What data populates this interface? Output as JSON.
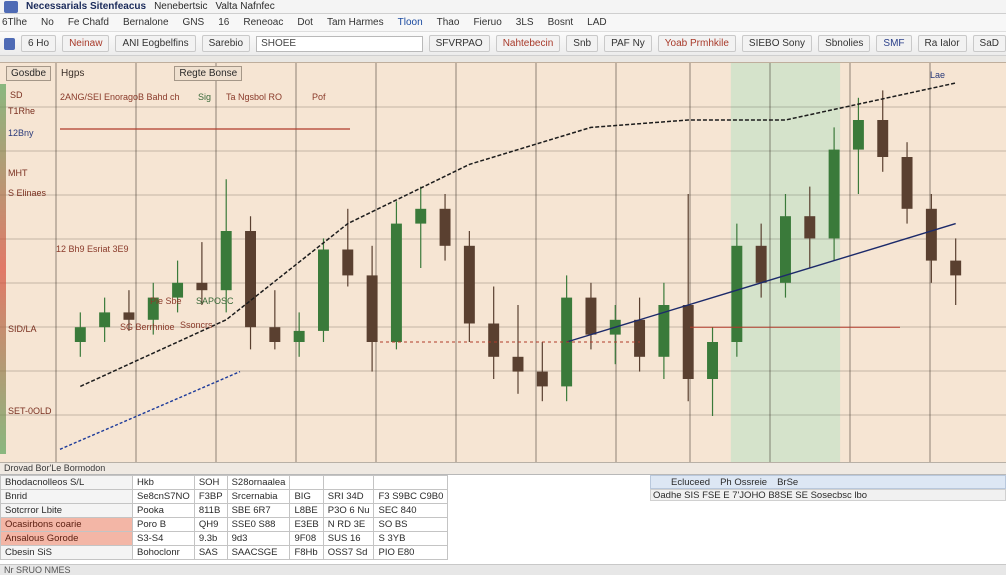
{
  "titlebar": {
    "title": "Necessarials Sitenfeacus",
    "items": [
      "Nenebertsic",
      "Valta Nafnfec"
    ]
  },
  "menubar": {
    "items": [
      "6Tlhe",
      "No",
      "Fe Chafd",
      "Bernalone",
      "GNS",
      "16",
      "Reneoac",
      "Dot",
      "Tam Harmes",
      "Tloon",
      "Thao",
      "Fieruo",
      "3LS",
      "Bosnt",
      "LAD"
    ]
  },
  "toolbar": {
    "b1": "6 Ho",
    "b2": "Neinaw",
    "b3": "ANI Eogbelfins",
    "b4": "Sarebio",
    "search_value": "SHOEE",
    "b5": "SFVRPAO",
    "b6": "Nahtebecin",
    "b7": "Snb",
    "b8": "PAF Ny",
    "b9": "Yoab Prmhkile",
    "b10": "SIEBO Sony",
    "b11": "Sbnolies",
    "b12": "SMF",
    "b13": "Ra Ialor",
    "b14": "SaD"
  },
  "chart_header": {
    "symbol": "Gosdbe",
    "tf": "Hgps",
    "study": "Regte Bonse",
    "right": "Lae"
  },
  "labels": {
    "l1": "SD",
    "l2": "12Bny",
    "l3": "2ANG/SEI Enorago",
    "l4": "B Bahd ch",
    "l5": "Sig",
    "l6": "Ta Ngsbol RO",
    "l7": "Pof",
    "l8": "T1Rhe",
    "l9": "MHT",
    "l10": "S Elinaes",
    "l11": "12 Bh9 Esriat 3E9",
    "l12": "Pie Sbe",
    "l13": "SAPOSC",
    "l14": "SG Berrhnioe",
    "l15": "SID/LA",
    "l16": "SET-0OLD",
    "l17": "Ssoncrs"
  },
  "status_strip": {
    "text": "Drovad Bor'Le Bormodon"
  },
  "table": {
    "headers": [
      "Bhodacnolleos S/L",
      "Hkb",
      "SOH",
      "S28ornaalea",
      "",
      "",
      "",
      ""
    ],
    "rows": [
      {
        "head": "Bnrid",
        "cells": [
          "Se8cnS7NO",
          "F3BP",
          "Srcernabia",
          "BIG",
          "SRI 34D",
          "F3 S9BC C9B0"
        ]
      },
      {
        "head": "Sotcrror Lbite",
        "cells": [
          "Pooka",
          "811B",
          "SBE 6R7",
          "L8BE",
          "P3O 6 Nu",
          "SEC 840"
        ]
      },
      {
        "head": "Ocasirbons coarie",
        "cells": [
          "Poro B",
          "QH9",
          "SSE0 S88",
          "E3EB",
          "N RD 3E",
          "SO BS"
        ]
      },
      {
        "head": "Ansalous Gorode",
        "cells": [
          "S3-S4",
          "9.3b",
          "9d3",
          "9F08",
          "SUS 16",
          "S 3YB"
        ]
      },
      {
        "head": "Cbesin SiS",
        "cells": [
          "Bohoclonr",
          "SAS",
          "SAACSGE",
          "F8Hb",
          "OSS7 Sd",
          "PIO E80"
        ]
      }
    ],
    "strip_top": [
      "Ecluceed",
      "Ph Ossreie",
      "BrSe"
    ],
    "strip_bottom": "Oadhe SIS FSE E 7'JOHO B8SE SE Sosecbsc lbo"
  },
  "footer": {
    "text": "Nr SRUO NMES"
  },
  "chart_data": {
    "type": "candlestick",
    "title": "",
    "xlabel": "",
    "ylabel": "",
    "ylim": [
      0,
      100
    ],
    "candles": [
      {
        "x": 1,
        "o": 30,
        "h": 38,
        "l": 26,
        "c": 34,
        "up": true
      },
      {
        "x": 2,
        "o": 34,
        "h": 42,
        "l": 30,
        "c": 38,
        "up": true
      },
      {
        "x": 3,
        "o": 38,
        "h": 44,
        "l": 33,
        "c": 36,
        "up": false
      },
      {
        "x": 4,
        "o": 36,
        "h": 46,
        "l": 32,
        "c": 42,
        "up": true
      },
      {
        "x": 5,
        "o": 42,
        "h": 52,
        "l": 38,
        "c": 46,
        "up": true
      },
      {
        "x": 6,
        "o": 46,
        "h": 57,
        "l": 40,
        "c": 44,
        "up": false
      },
      {
        "x": 7,
        "o": 44,
        "h": 74,
        "l": 38,
        "c": 60,
        "up": true
      },
      {
        "x": 8,
        "o": 60,
        "h": 64,
        "l": 28,
        "c": 34,
        "up": false
      },
      {
        "x": 9,
        "o": 34,
        "h": 44,
        "l": 28,
        "c": 30,
        "up": false
      },
      {
        "x": 10,
        "o": 30,
        "h": 38,
        "l": 26,
        "c": 33,
        "up": true
      },
      {
        "x": 11,
        "o": 33,
        "h": 58,
        "l": 30,
        "c": 55,
        "up": true
      },
      {
        "x": 12,
        "o": 55,
        "h": 66,
        "l": 45,
        "c": 48,
        "up": false
      },
      {
        "x": 13,
        "o": 48,
        "h": 56,
        "l": 22,
        "c": 30,
        "up": false
      },
      {
        "x": 14,
        "o": 30,
        "h": 68,
        "l": 28,
        "c": 62,
        "up": true
      },
      {
        "x": 15,
        "o": 62,
        "h": 72,
        "l": 50,
        "c": 66,
        "up": true
      },
      {
        "x": 16,
        "o": 66,
        "h": 70,
        "l": 52,
        "c": 56,
        "up": false
      },
      {
        "x": 17,
        "o": 56,
        "h": 60,
        "l": 30,
        "c": 35,
        "up": false
      },
      {
        "x": 18,
        "o": 35,
        "h": 45,
        "l": 20,
        "c": 26,
        "up": false
      },
      {
        "x": 19,
        "o": 26,
        "h": 40,
        "l": 16,
        "c": 22,
        "up": false
      },
      {
        "x": 20,
        "o": 22,
        "h": 30,
        "l": 14,
        "c": 18,
        "up": false
      },
      {
        "x": 21,
        "o": 18,
        "h": 48,
        "l": 14,
        "c": 42,
        "up": true
      },
      {
        "x": 22,
        "o": 42,
        "h": 46,
        "l": 28,
        "c": 32,
        "up": false
      },
      {
        "x": 23,
        "o": 32,
        "h": 40,
        "l": 24,
        "c": 36,
        "up": true
      },
      {
        "x": 24,
        "o": 36,
        "h": 42,
        "l": 22,
        "c": 26,
        "up": false
      },
      {
        "x": 25,
        "o": 26,
        "h": 46,
        "l": 20,
        "c": 40,
        "up": true
      },
      {
        "x": 26,
        "o": 40,
        "h": 70,
        "l": 14,
        "c": 20,
        "up": false
      },
      {
        "x": 27,
        "o": 20,
        "h": 34,
        "l": 10,
        "c": 30,
        "up": true
      },
      {
        "x": 28,
        "o": 30,
        "h": 62,
        "l": 26,
        "c": 56,
        "up": true
      },
      {
        "x": 29,
        "o": 56,
        "h": 62,
        "l": 42,
        "c": 46,
        "up": false
      },
      {
        "x": 30,
        "o": 46,
        "h": 70,
        "l": 42,
        "c": 64,
        "up": true
      },
      {
        "x": 31,
        "o": 64,
        "h": 72,
        "l": 50,
        "c": 58,
        "up": false
      },
      {
        "x": 32,
        "o": 58,
        "h": 88,
        "l": 52,
        "c": 82,
        "up": true
      },
      {
        "x": 33,
        "o": 82,
        "h": 96,
        "l": 70,
        "c": 90,
        "up": true
      },
      {
        "x": 34,
        "o": 90,
        "h": 98,
        "l": 76,
        "c": 80,
        "up": false
      },
      {
        "x": 35,
        "o": 80,
        "h": 84,
        "l": 62,
        "c": 66,
        "up": false
      },
      {
        "x": 36,
        "o": 66,
        "h": 70,
        "l": 46,
        "c": 52,
        "up": false
      },
      {
        "x": 37,
        "o": 52,
        "h": 58,
        "l": 40,
        "c": 48,
        "up": false
      }
    ],
    "trend_line": [
      [
        1,
        18
      ],
      [
        7,
        36
      ],
      [
        12,
        62
      ],
      [
        17,
        78
      ],
      [
        22,
        88
      ],
      [
        26,
        90
      ],
      [
        30,
        90
      ],
      [
        37,
        100
      ]
    ],
    "trend_line2": [
      [
        21,
        30
      ],
      [
        28,
        44
      ],
      [
        37,
        62
      ]
    ],
    "highlight_zone": [
      28,
      32
    ]
  }
}
